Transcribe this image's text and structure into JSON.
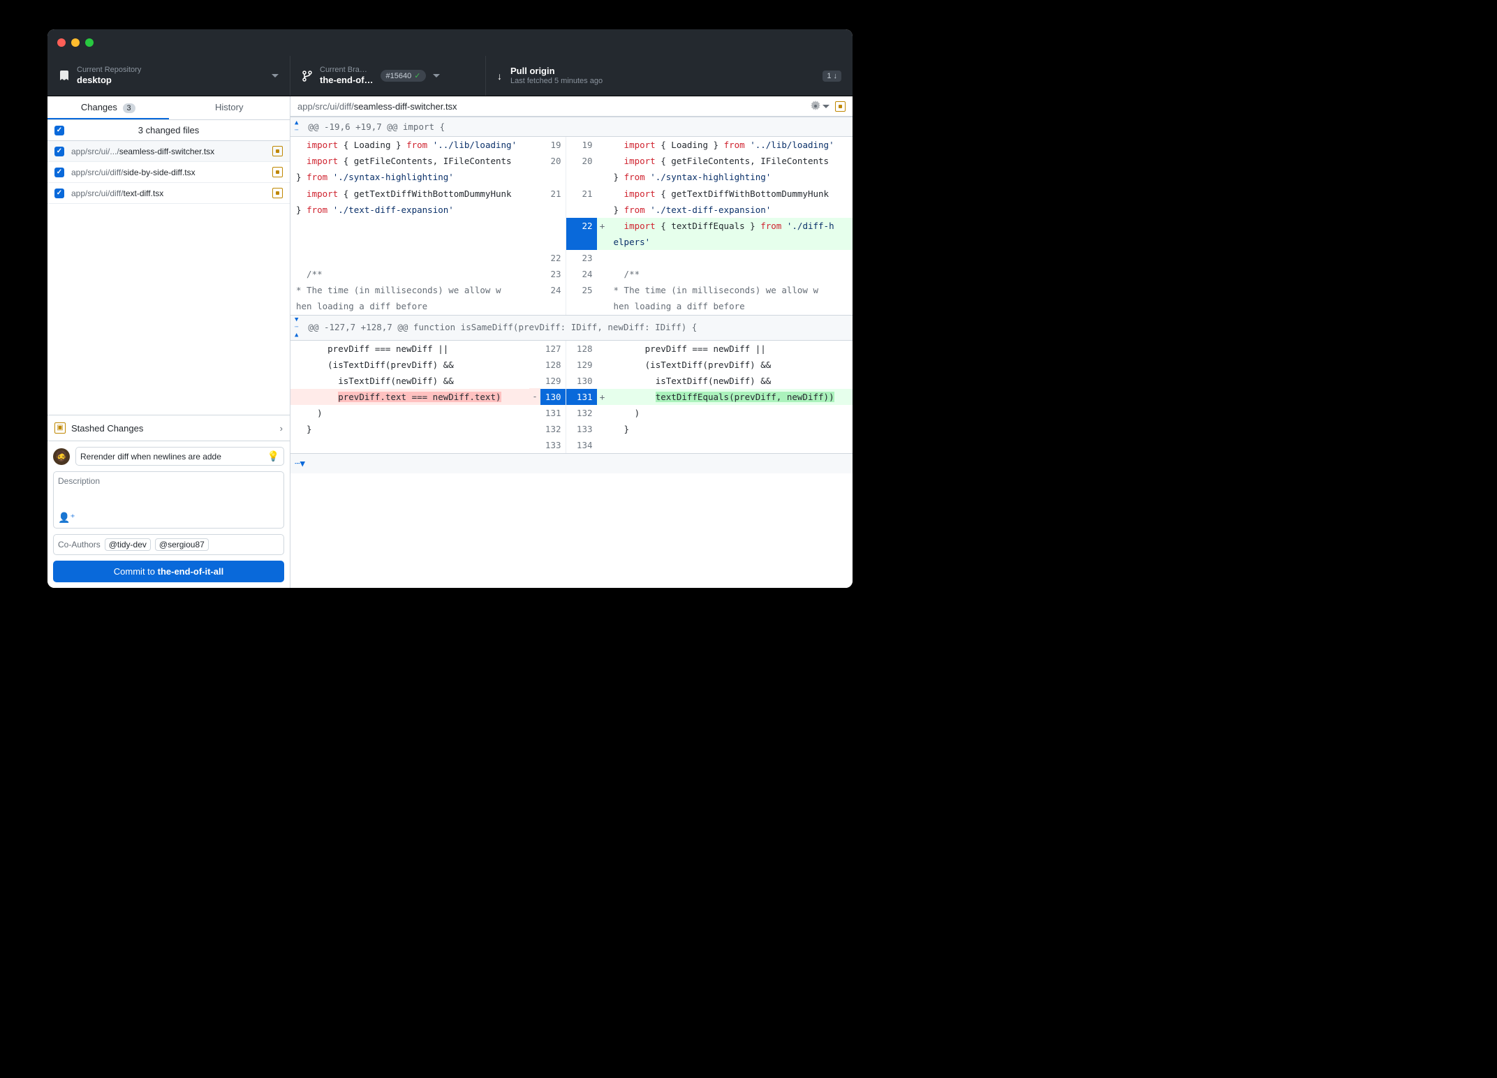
{
  "toolbar": {
    "repo_label": "Current Repository",
    "repo_value": "desktop",
    "branch_label": "Current Bra…",
    "branch_value": "the-end-of…",
    "pr_number": "#15640",
    "pull_label": "Pull origin",
    "pull_sub": "Last fetched 5 minutes ago",
    "pull_count": "1 ↓"
  },
  "tabs": {
    "changes": "Changes",
    "changes_count": "3",
    "history": "History"
  },
  "files": {
    "summary": "3 changed files",
    "items": [
      {
        "dir": "app/src/ui/.../",
        "name": "seamless-diff-switcher.tsx"
      },
      {
        "dir": "app/src/ui/diff/",
        "name": "side-by-side-diff.tsx"
      },
      {
        "dir": "app/src/ui/diff/",
        "name": "text-diff.tsx"
      }
    ]
  },
  "stash": {
    "label": "Stashed Changes"
  },
  "commit": {
    "summary": "Rerender diff when newlines are adde",
    "desc_placeholder": "Description",
    "coauthors_label": "Co-Authors",
    "coauthors": [
      "@tidy-dev",
      "@sergiou87"
    ],
    "button_prefix": "Commit to ",
    "button_branch": "the-end-of-it-all"
  },
  "path": {
    "dir": "app/src/ui/diff/",
    "file": "seamless-diff-switcher.tsx"
  },
  "diff": {
    "hunk1": "@@ -19,6 +19,7 @@ import {",
    "l1": {
      "nL": "19",
      "nR": "19",
      "left": "  import { Loading } from '../lib/loading'",
      "right": "  import { Loading } from '../lib/loading'"
    },
    "l2": {
      "nL": "20",
      "nR": "20",
      "left": "  import { getFileContents, IFileContents } from './syntax-highlighting'",
      "right": "  import { getFileContents, IFileContents } from './syntax-highlighting'"
    },
    "l3": {
      "nL": "21",
      "nR": "21",
      "left": "  import { getTextDiffWithBottomDummyHunk } from './text-diff-expansion'",
      "right": "  import { getTextDiffWithBottomDummyHunk } from './text-diff-expansion'"
    },
    "l4": {
      "nR": "22",
      "right": "  import { textDiffEquals } from './diff-helpers'"
    },
    "l5": {
      "nL": "22",
      "nR": "23"
    },
    "l6": {
      "nL": "23",
      "nR": "24",
      "left": "  /**",
      "right": "  /**"
    },
    "l7": {
      "nL": "24",
      "nR": "25",
      "left": "   * The time (in milliseconds) we allow when loading a diff before",
      "right": "   * The time (in milliseconds) we allow when loading a diff before"
    },
    "hunk2": "@@ -127,7 +128,7 @@ function isSameDiff(prevDiff: IDiff, newDiff: IDiff) {",
    "l8": {
      "nL": "127",
      "nR": "128",
      "left": "      prevDiff === newDiff ||",
      "right": "      prevDiff === newDiff ||"
    },
    "l9": {
      "nL": "128",
      "nR": "129",
      "left": "      (isTextDiff(prevDiff) &&",
      "right": "      (isTextDiff(prevDiff) &&"
    },
    "l10": {
      "nL": "129",
      "nR": "130",
      "left": "        isTextDiff(newDiff) &&",
      "right": "        isTextDiff(newDiff) &&"
    },
    "l11": {
      "nL": "130",
      "nR": "131",
      "left": "        prevDiff.text === newDiff.text)",
      "right": "        textDiffEquals(prevDiff, newDiff))"
    },
    "l12": {
      "nL": "131",
      "nR": "132",
      "left": "    )",
      "right": "    )"
    },
    "l13": {
      "nL": "132",
      "nR": "133",
      "left": "  }",
      "right": "  }"
    },
    "l14": {
      "nL": "133",
      "nR": "134"
    }
  }
}
